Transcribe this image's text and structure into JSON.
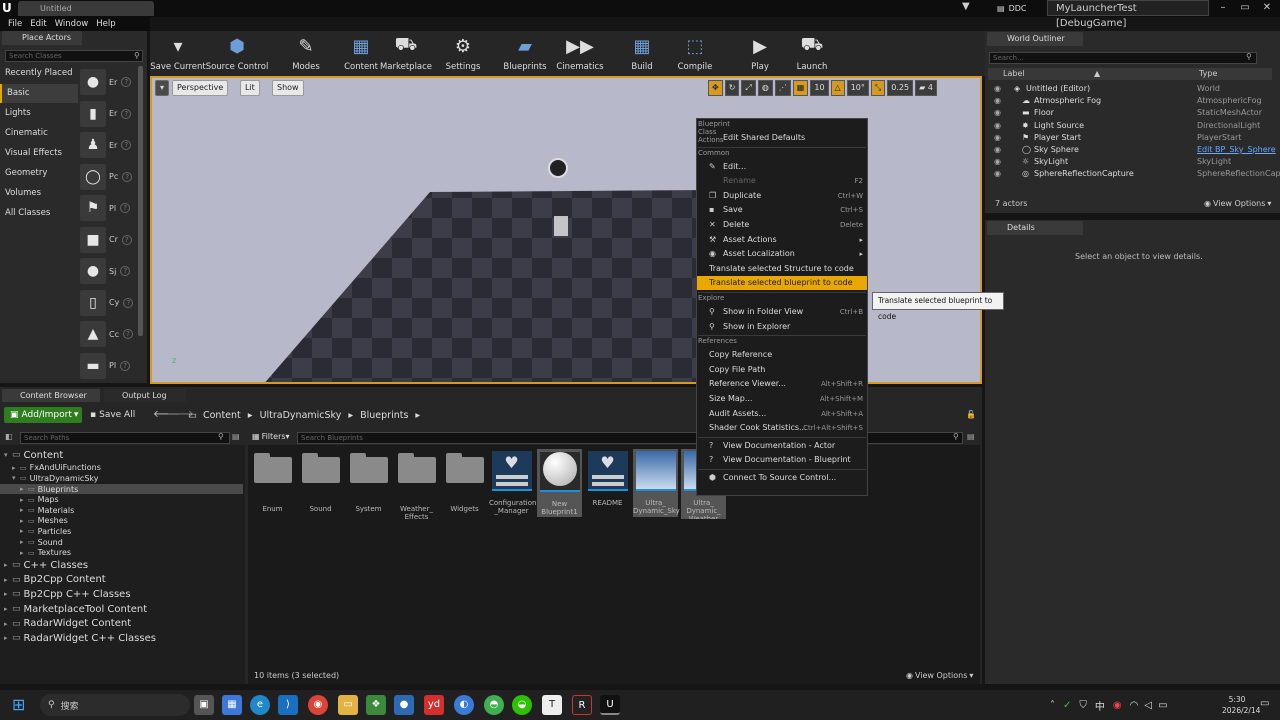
{
  "window": {
    "tab_title": "Untitled",
    "ddc_label": "DDC",
    "project_name": "MyLauncherTest [DebugGame]"
  },
  "menu": [
    "File",
    "Edit",
    "Window",
    "Help"
  ],
  "place_actors": {
    "tab_label": "Place Actors",
    "search_placeholder": "Search Classes",
    "categories": [
      "Recently Placed",
      "Basic",
      "Lights",
      "Cinematic",
      "Visual Effects",
      "Geometry",
      "Volumes",
      "All Classes"
    ],
    "active_category": "Basic",
    "items": [
      "Er",
      "Er",
      "Er",
      "Pc",
      "Pl",
      "Cr",
      "Sj",
      "Cy",
      "Cc",
      "Pl"
    ]
  },
  "toolbar": {
    "buttons": [
      "Save Current",
      "Source Control",
      "Modes",
      "Content",
      "Marketplace",
      "Settings",
      "Blueprints",
      "Cinematics",
      "Build",
      "Compile",
      "Play",
      "Launch"
    ]
  },
  "viewport": {
    "perspective_label": "Perspective",
    "lit_label": "Lit",
    "show_label": "Show",
    "snap_grid": "10",
    "snap_rotation": "10°",
    "snap_scale": "0.25",
    "camera_speed": "4"
  },
  "world_outliner": {
    "tab_label": "World Outliner",
    "search_placeholder": "Search...",
    "col_label": "Label",
    "col_type": "Type",
    "rows": [
      {
        "label": "Untitled (Editor)",
        "type": "World"
      },
      {
        "label": "Atmospheric Fog",
        "type": "AtmosphericFog"
      },
      {
        "label": "Floor",
        "type": "StaticMeshActor"
      },
      {
        "label": "Light Source",
        "type": "DirectionalLight"
      },
      {
        "label": "Player Start",
        "type": "PlayerStart"
      },
      {
        "label": "Sky Sphere",
        "type": "Edit BP_Sky_Sphere"
      },
      {
        "label": "SkyLight",
        "type": "SkyLight"
      },
      {
        "label": "SphereReflectionCapture",
        "type": "SphereReflectionCapt"
      }
    ],
    "actor_count": "7 actors",
    "view_options": "View Options"
  },
  "details": {
    "tab_label": "Details",
    "empty_message": "Select an object to view details."
  },
  "content_browser": {
    "tab_label": "Content Browser",
    "output_log_tab": "Output Log",
    "add_import": "Add/Import",
    "save_all": "Save All",
    "breadcrumb": [
      "Content",
      "UltraDynamicSky",
      "Blueprints"
    ],
    "search_paths_placeholder": "Search Paths",
    "filters_label": "Filters",
    "search_placeholder": "Search Blueprints",
    "tree": [
      {
        "label": "Content",
        "level": 0,
        "big": true
      },
      {
        "label": "FxAndUiFunctions",
        "level": 1
      },
      {
        "label": "UltraDynamicSky",
        "level": 1
      },
      {
        "label": "Blueprints",
        "level": 2,
        "selected": true
      },
      {
        "label": "Maps",
        "level": 2
      },
      {
        "label": "Materials",
        "level": 2
      },
      {
        "label": "Meshes",
        "level": 2
      },
      {
        "label": "Particles",
        "level": 2
      },
      {
        "label": "Sound",
        "level": 2
      },
      {
        "label": "Textures",
        "level": 2
      },
      {
        "label": "C++ Classes",
        "level": 0,
        "big": true
      },
      {
        "label": "Bp2Cpp Content",
        "level": 0,
        "big": true
      },
      {
        "label": "Bp2Cpp C++ Classes",
        "level": 0,
        "big": true
      },
      {
        "label": "MarketplaceTool Content",
        "level": 0,
        "big": true
      },
      {
        "label": "RadarWidget Content",
        "level": 0,
        "big": true
      },
      {
        "label": "RadarWidget C++ Classes",
        "level": 0,
        "big": true
      }
    ],
    "assets": [
      {
        "label": "Enum",
        "kind": "folder"
      },
      {
        "label": "Sound",
        "kind": "folder"
      },
      {
        "label": "System",
        "kind": "folder"
      },
      {
        "label": "Weather_ Effects",
        "kind": "folder"
      },
      {
        "label": "Widgets",
        "kind": "folder"
      },
      {
        "label": "Configuration _Manager",
        "kind": "struct"
      },
      {
        "label": "New Blueprint1",
        "kind": "sphere"
      },
      {
        "label": "README",
        "kind": "struct"
      },
      {
        "label": "Ultra_ Dynamic_Sky",
        "kind": "sky"
      },
      {
        "label": "Ultra_ Dynamic_ Weather",
        "kind": "sky"
      }
    ],
    "status": "10 items (3 selected)",
    "view_options": "View Options"
  },
  "context_menu": {
    "sections": [
      {
        "header": "Blueprint Class Actions",
        "items": [
          {
            "label": "Edit Shared Defaults",
            "icon": "none",
            "shortcut": ""
          }
        ]
      },
      {
        "header": "Common",
        "items": [
          {
            "label": "Edit...",
            "icon": "pencil-icon",
            "shortcut": ""
          },
          {
            "label": "Rename",
            "icon": "none",
            "shortcut": "F2",
            "disabled": true
          },
          {
            "label": "Duplicate",
            "icon": "duplicate-icon",
            "shortcut": "Ctrl+W"
          },
          {
            "label": "Save",
            "icon": "save-icon",
            "shortcut": "Ctrl+S"
          },
          {
            "label": "Delete",
            "icon": "delete-icon",
            "shortcut": "Delete"
          },
          {
            "label": "Asset Actions",
            "icon": "wrench-icon",
            "shortcut": "",
            "submenu": true
          },
          {
            "label": "Asset Localization",
            "icon": "globe-icon",
            "shortcut": "",
            "submenu": true
          },
          {
            "label": "Translate selected Structure to code",
            "icon": "none",
            "shortcut": "",
            "plain": true
          },
          {
            "label": "Translate selected blueprint to code",
            "icon": "none",
            "shortcut": "",
            "plain": true,
            "highlight": true
          }
        ]
      },
      {
        "header": "Explore",
        "items": [
          {
            "label": "Show in Folder View",
            "icon": "search-icon",
            "shortcut": "Ctrl+B"
          },
          {
            "label": "Show in Explorer",
            "icon": "search-icon",
            "shortcut": ""
          }
        ]
      },
      {
        "header": "References",
        "items": [
          {
            "label": "Copy Reference",
            "icon": "none",
            "shortcut": "",
            "plain": true
          },
          {
            "label": "Copy File Path",
            "icon": "none",
            "shortcut": "",
            "plain": true
          },
          {
            "label": "Reference Viewer...",
            "icon": "none",
            "shortcut": "Alt+Shift+R",
            "plain": true
          },
          {
            "label": "Size Map...",
            "icon": "none",
            "shortcut": "Alt+Shift+M",
            "plain": true
          },
          {
            "label": "Audit Assets...",
            "icon": "none",
            "shortcut": "Alt+Shift+A",
            "plain": true
          },
          {
            "label": "Shader Cook Statistics...",
            "icon": "none",
            "shortcut": "Ctrl+Alt+Shift+S",
            "plain": true
          }
        ]
      },
      {
        "header": "",
        "items": [
          {
            "label": "View Documentation - Actor",
            "icon": "help-icon",
            "shortcut": ""
          },
          {
            "label": "View Documentation - Blueprint",
            "icon": "help-icon",
            "shortcut": ""
          }
        ]
      },
      {
        "header": "",
        "items": [
          {
            "label": "Connect To Source Control...",
            "icon": "source-control-icon",
            "shortcut": ""
          }
        ]
      }
    ],
    "tooltip": "Translate selected blueprint to code"
  },
  "taskbar": {
    "search_label": "搜索",
    "time": "5:30",
    "date": "2026/2/14",
    "ime": "中"
  },
  "colors": {
    "accent": "#d59a22",
    "highlight": "#e8a800",
    "add_import": "#2e7d1f"
  }
}
